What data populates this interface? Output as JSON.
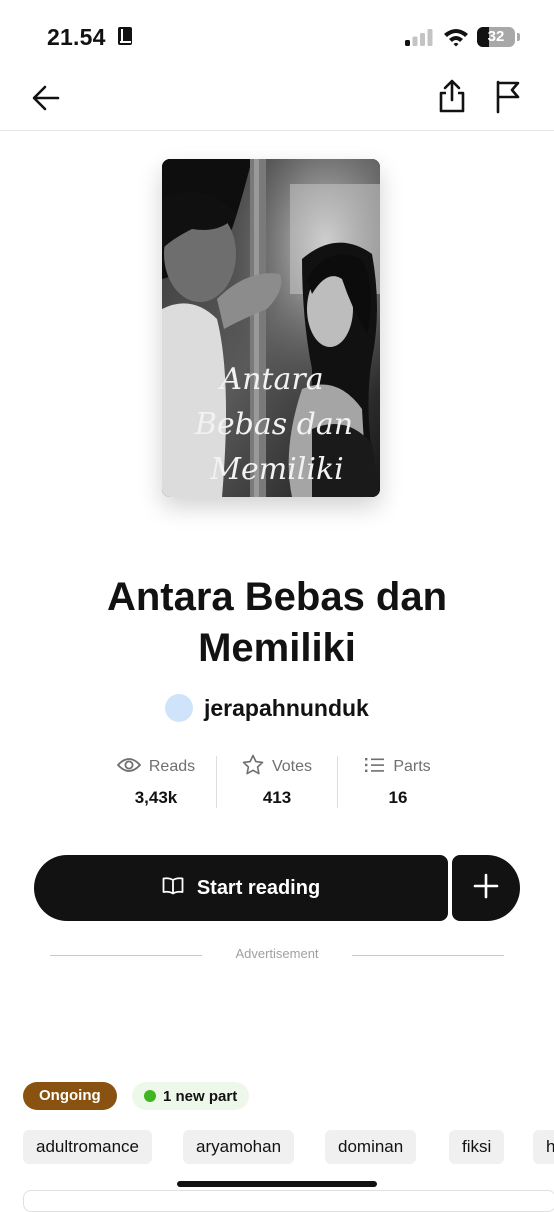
{
  "status_bar": {
    "time": "21.54",
    "time_icon": "book-icon",
    "signal_icon": "cellular-signal-icon",
    "wifi_icon": "wifi-icon",
    "battery_level": "32"
  },
  "nav": {
    "back_icon": "arrow-left-icon",
    "share_icon": "share-icon",
    "report_icon": "flag-icon"
  },
  "cover": {
    "title_text": "Antara Bebas dan Memiliki",
    "lines": [
      "Antara",
      "Bebas dan",
      "Memiliki"
    ]
  },
  "story": {
    "title": "Antara Bebas dan Memiliki",
    "author": "jerapahnunduk"
  },
  "stats": {
    "reads": {
      "label": "Reads",
      "value": "3,43k",
      "icon": "eye-icon"
    },
    "votes": {
      "label": "Votes",
      "value": "413",
      "icon": "star-icon"
    },
    "parts": {
      "label": "Parts",
      "value": "16",
      "icon": "list-icon"
    }
  },
  "actions": {
    "start_reading": "Start reading",
    "start_icon": "open-book-icon",
    "add_icon": "plus-icon"
  },
  "advertisement_label": "Advertisement",
  "status_badges": {
    "ongoing": "Ongoing",
    "new_parts": "1 new part"
  },
  "tags": [
    "adultromance",
    "aryamohan",
    "dominan",
    "fiksi",
    "h"
  ],
  "colors": {
    "primary_dark": "#121212",
    "ongoing_badge": "#8a5211",
    "new_dot": "#3fb51f",
    "new_badge_bg": "#eef8ea",
    "avatar": "#cfe3fb"
  }
}
